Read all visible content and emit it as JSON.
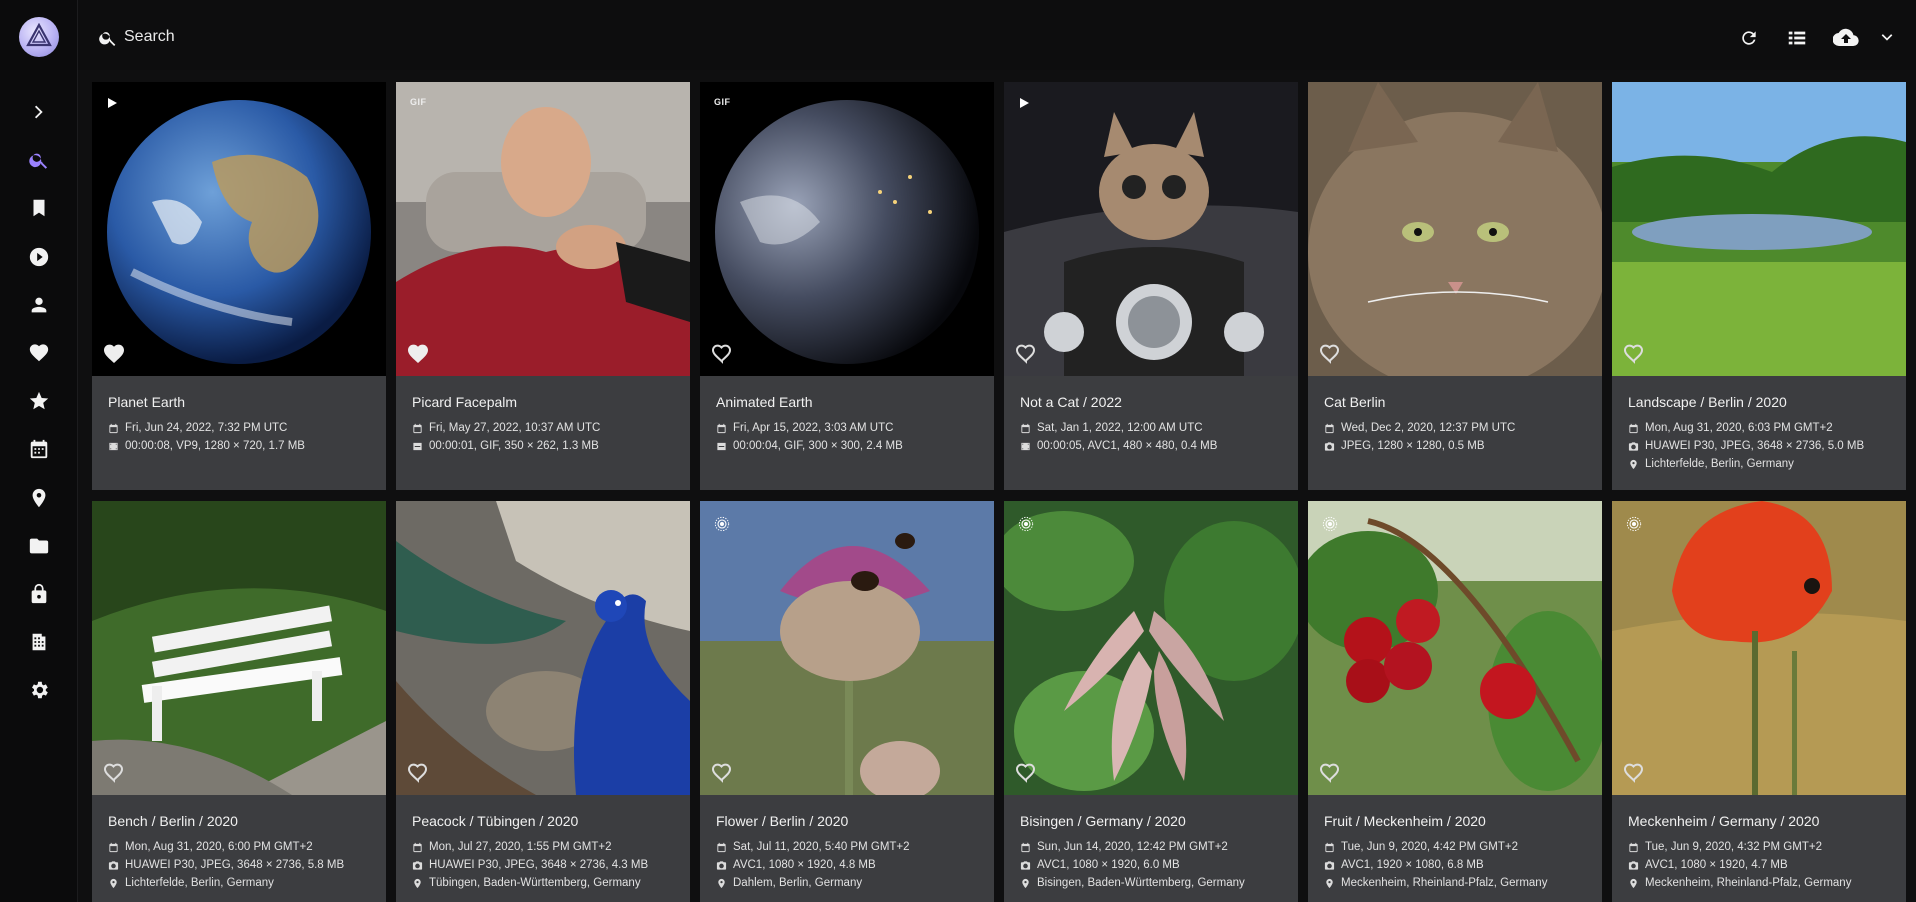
{
  "search": {
    "placeholder": "Search"
  },
  "sidebar": {
    "items": [
      {
        "icon": "chevron-right-icon"
      },
      {
        "icon": "search-icon"
      },
      {
        "icon": "bookmark-icon"
      },
      {
        "icon": "play-icon"
      },
      {
        "icon": "person-icon"
      },
      {
        "icon": "heart-icon"
      },
      {
        "icon": "star-icon"
      },
      {
        "icon": "calendar-icon"
      },
      {
        "icon": "location-icon"
      },
      {
        "icon": "folder-icon"
      },
      {
        "icon": "lock-icon"
      },
      {
        "icon": "library-icon"
      },
      {
        "icon": "gear-icon"
      }
    ]
  },
  "toolbar": {
    "buttons": [
      "refresh-icon",
      "list-view-icon",
      "upload-icon",
      "chevron-down-icon"
    ]
  },
  "photos": [
    {
      "title": "Planet Earth",
      "date": "Fri, Jun 24, 2022, 7:32 PM UTC",
      "detail": "00:00:08, VP9, 1280 × 720, 1.7 MB",
      "detail_icon": "video-icon",
      "location": "",
      "badge": "play"
    },
    {
      "title": "Picard Facepalm",
      "date": "Fri, May 27, 2022, 10:37 AM UTC",
      "detail": "00:00:01, GIF, 350 × 262, 1.3 MB",
      "detail_icon": "gif-icon",
      "location": "",
      "badge": "GIF"
    },
    {
      "title": "Animated Earth",
      "date": "Fri, Apr 15, 2022, 3:03 AM UTC",
      "detail": "00:00:04, GIF, 300 × 300, 2.4 MB",
      "detail_icon": "gif-icon",
      "location": "",
      "badge": "GIF"
    },
    {
      "title": "Not a Cat / 2022",
      "date": "Sat, Jan 1, 2022, 12:00 AM UTC",
      "detail": "00:00:05, AVC1, 480 × 480, 0.4 MB",
      "detail_icon": "video-icon",
      "location": "",
      "badge": "play"
    },
    {
      "title": "Cat Berlin",
      "date": "Wed, Dec 2, 2020, 12:37 PM UTC",
      "detail": "JPEG, 1280 × 1280, 0.5 MB",
      "detail_icon": "camera-icon",
      "location": "",
      "badge": ""
    },
    {
      "title": "Landscape / Berlin / 2020",
      "date": "Mon, Aug 31, 2020, 6:03 PM GMT+2",
      "detail": "HUAWEI P30, JPEG, 3648 × 2736, 5.0 MB",
      "detail_icon": "camera-icon",
      "location": "Lichterfelde, Berlin, Germany",
      "badge": ""
    },
    {
      "title": "Bench / Berlin / 2020",
      "date": "Mon, Aug 31, 2020, 6:00 PM GMT+2",
      "detail": "HUAWEI P30, JPEG, 3648 × 2736, 5.8 MB",
      "detail_icon": "camera-icon",
      "location": "Lichterfelde, Berlin, Germany",
      "badge": ""
    },
    {
      "title": "Peacock / Tübingen / 2020",
      "date": "Mon, Jul 27, 2020, 1:55 PM GMT+2",
      "detail": "HUAWEI P30, JPEG, 3648 × 2736, 4.3 MB",
      "detail_icon": "camera-icon",
      "location": "Tübingen, Baden-Württemberg, Germany",
      "badge": ""
    },
    {
      "title": "Flower / Berlin / 2020",
      "date": "Sat, Jul 11, 2020, 5:40 PM GMT+2",
      "detail": "AVC1, 1080 × 1920, 4.8 MB",
      "detail_icon": "camera-icon",
      "location": "Dahlem, Berlin, Germany",
      "badge": "live"
    },
    {
      "title": "Bisingen / Germany / 2020",
      "date": "Sun, Jun 14, 2020, 12:42 PM GMT+2",
      "detail": "AVC1, 1080 × 1920, 6.0 MB",
      "detail_icon": "camera-icon",
      "location": "Bisingen, Baden-Württemberg, Germany",
      "badge": "live"
    },
    {
      "title": "Fruit / Meckenheim / 2020",
      "date": "Tue, Jun 9, 2020, 4:42 PM GMT+2",
      "detail": "AVC1, 1920 × 1080, 6.8 MB",
      "detail_icon": "camera-icon",
      "location": "Meckenheim, Rheinland-Pfalz, Germany",
      "badge": "live"
    },
    {
      "title": "Meckenheim / Germany / 2020",
      "date": "Tue, Jun 9, 2020, 4:32 PM GMT+2",
      "detail": "AVC1, 1080 × 1920, 4.7 MB",
      "detail_icon": "camera-icon",
      "location": "Meckenheim, Rheinland-Pfalz, Germany",
      "badge": "live"
    }
  ]
}
